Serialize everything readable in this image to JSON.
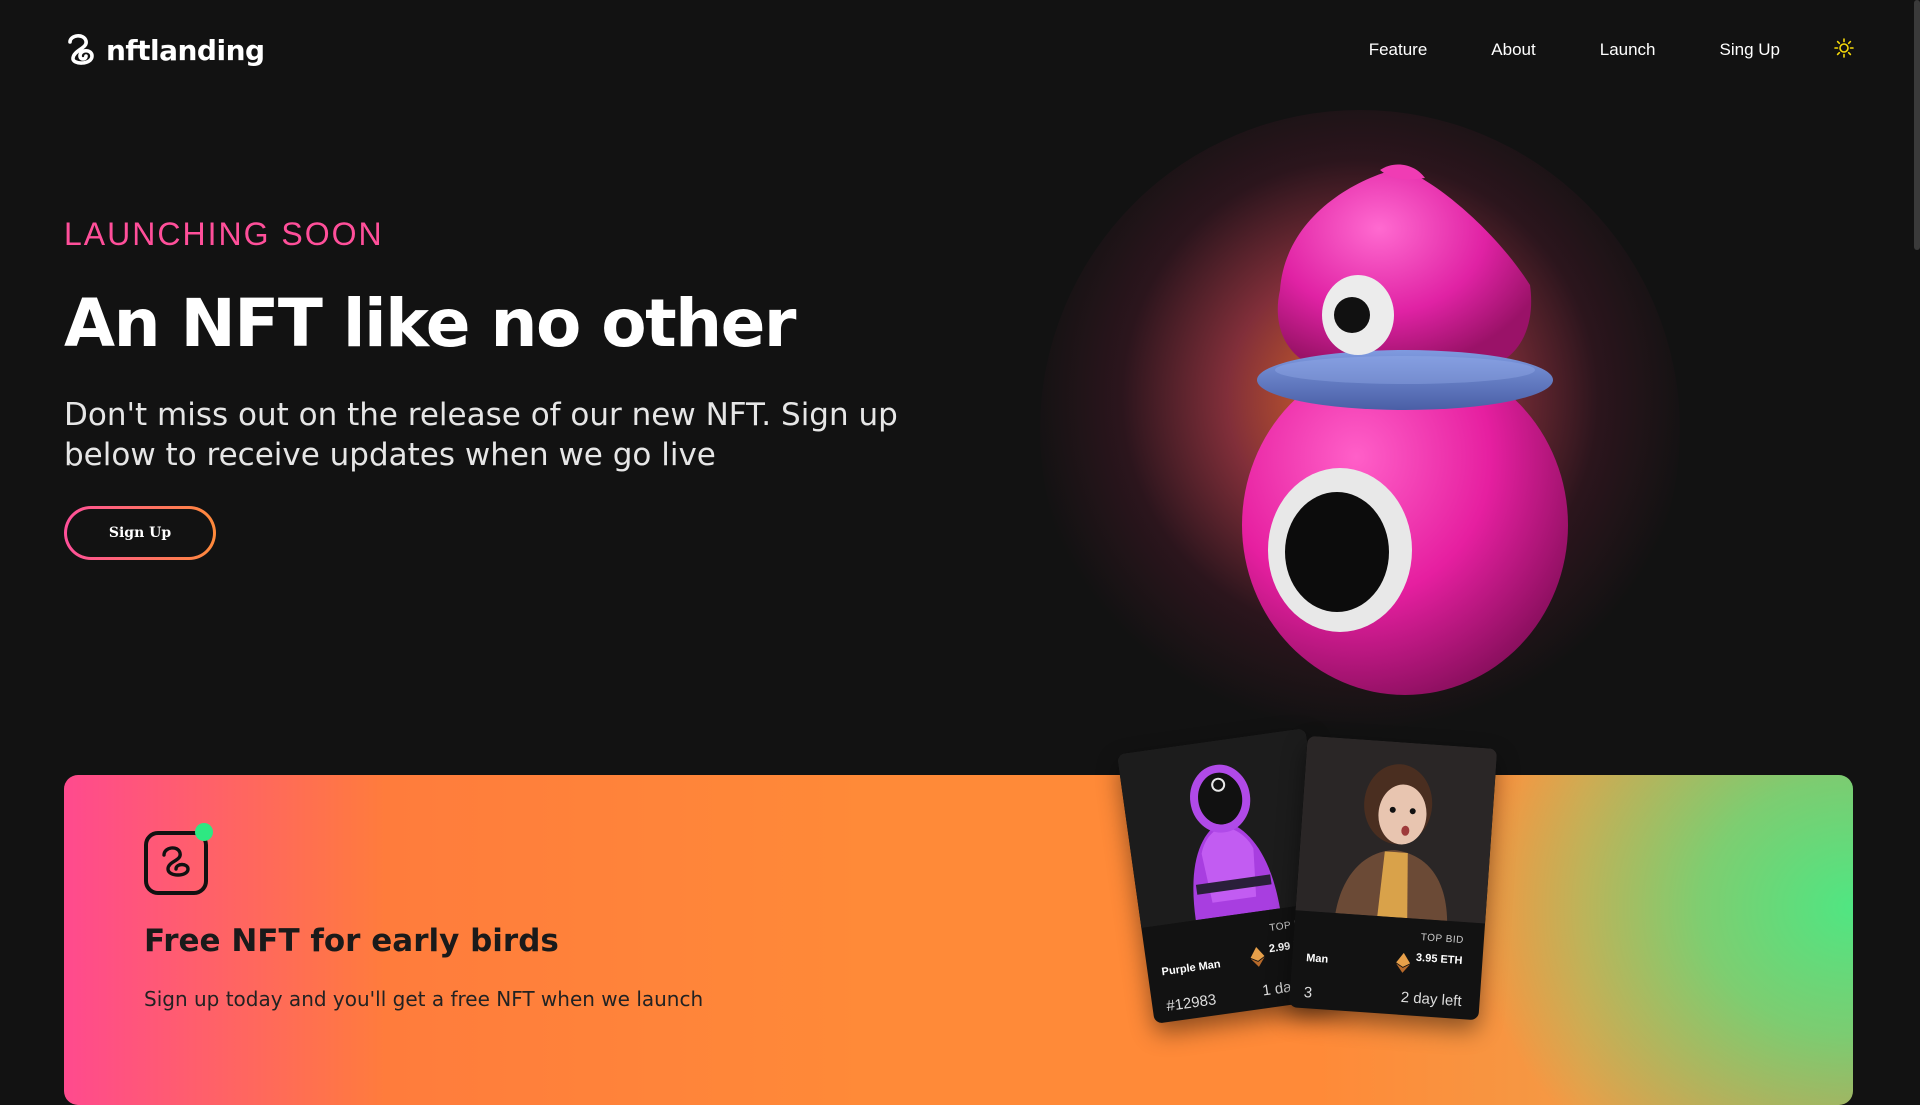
{
  "nav": {
    "logo_text": "nftlanding",
    "links": [
      "Feature",
      "About",
      "Launch",
      "Sing Up"
    ],
    "theme_icon": "sun-icon"
  },
  "hero": {
    "eyebrow": "LAUNCHING SOON",
    "title": "An NFT like no other",
    "subtitle": "Don't miss out on the release of our new NFT. Sign up below to receive updates when we go live",
    "cta_label": "Sign Up"
  },
  "banner": {
    "title": "Free NFT for early birds",
    "text": "Sign up today and you'll get a free NFT when we launch"
  },
  "cards": [
    {
      "name": "Purple Man",
      "top_bid_label": "TOP BID",
      "price": "2.99 ETH",
      "id": "#12983",
      "time_left": "1 day left"
    },
    {
      "name": "Man",
      "top_bid_label": "TOP BID",
      "price": "3.95 ETH",
      "id": "3",
      "time_left": "2 day left"
    }
  ],
  "colors": {
    "background": "#121212",
    "accent_pink": "#ff4f9a",
    "accent_orange": "#ff8a3a",
    "accent_green": "#2ee882",
    "theme_icon": "#f5d90a"
  }
}
